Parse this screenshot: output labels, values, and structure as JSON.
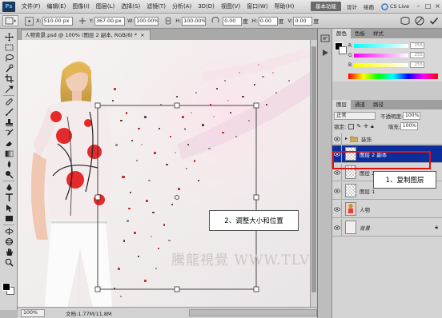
{
  "menubar": {
    "logo": "Ps",
    "items": [
      "文件(F)",
      "编辑(E)",
      "图像(I)",
      "图层(L)",
      "选择(S)",
      "滤镜(T)",
      "分析(A)",
      "3D(D)",
      "视图(V)",
      "窗口(W)",
      "帮助(H)"
    ],
    "workspace_active": "基本功能",
    "workspace_links": [
      "设计",
      "绘画"
    ],
    "cs_live": "CS Live"
  },
  "optbar": {
    "x_label": "X:",
    "x_value": "510.00 px",
    "y_label": "Y:",
    "y_value": "367.00 px",
    "w_label": "W:",
    "w_value": "100.00%",
    "h_label": "H:",
    "h_value": "100.00%",
    "angle_value": "0.00",
    "angle_unit": "度",
    "hskew_label": "H:",
    "hskew_value": "0.00",
    "vskew_label": "V:",
    "vskew_value": "0.00",
    "deg": "度"
  },
  "document": {
    "tab_title": "人物背景.psd @ 100% (图层 2 副本, RGB/8) *",
    "zoom": "100%",
    "doc_size": "文档:1.77M/11.8M",
    "watermark": "騰龍視覺 WWW.TLVI.NET"
  },
  "panels": {
    "color_tabs": [
      "颜色",
      "色板",
      "样式"
    ],
    "color_values": [
      "255",
      "255",
      "255"
    ],
    "channels": [
      "R",
      "G",
      "B"
    ],
    "layer_tabs": [
      "图层",
      "通道",
      "路径"
    ],
    "blend_mode": "正常",
    "opacity_label": "不透明度:",
    "opacity_value": "100%",
    "lock_label": "锁定:",
    "fill_label": "填充:",
    "fill_value": "100%",
    "layers": [
      {
        "name": "装饰",
        "kind": "group"
      },
      {
        "name": "图层 2 副本",
        "kind": "layer",
        "selected": true
      },
      {
        "name": "图层 2",
        "kind": "layer"
      },
      {
        "name": "图层 1",
        "kind": "layer"
      },
      {
        "name": "人物",
        "kind": "photo"
      },
      {
        "name": "背景",
        "kind": "background"
      }
    ]
  },
  "annotations": {
    "step1": "1、复制图层",
    "step2": "2、调整大小和位置"
  },
  "colors": {
    "selected_layer": "#0c2e9c",
    "highlight": "#dd1111",
    "accent_red": "#e02020"
  }
}
